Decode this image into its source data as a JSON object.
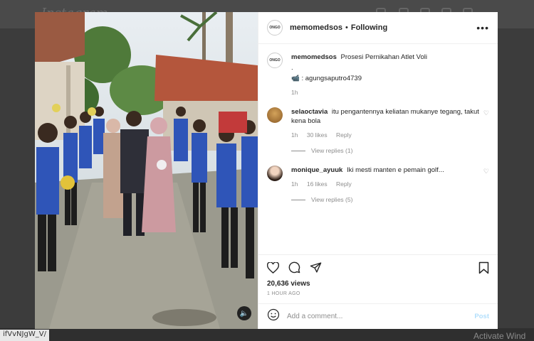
{
  "background": {
    "logo": "Instagram",
    "url_fragment": "ifVvNJgW_V/",
    "watermark": "Activate Wind"
  },
  "post": {
    "username": "memomedsos",
    "follow_status": "Following",
    "separator": "•",
    "avatar_text": "ONGO",
    "caption": {
      "username": "memomedsos",
      "text": "Prosesi Pernikahan Atlet Voli",
      "dot": ".",
      "credit": ": agungsaputro4739",
      "time": "1h"
    },
    "comments": [
      {
        "username": "selaoctavia",
        "text": "itu pengantennya keliatan mukanye tegang, takut kena bola",
        "time": "1h",
        "likes": "30 likes",
        "reply_label": "Reply",
        "view_replies": "View replies (1)"
      },
      {
        "username": "monique_ayuuk",
        "text": "Iki mesti manten e pemain golf...",
        "time": "1h",
        "likes": "16 likes",
        "reply_label": "Reply",
        "view_replies": "View replies (5)"
      }
    ],
    "views": "20,636 views",
    "posted_ago": "1 HOUR AGO",
    "add_comment_placeholder": "Add a comment...",
    "post_label": "Post",
    "icons": [
      "heart-icon",
      "comment-icon",
      "share-icon",
      "bookmark-icon",
      "emoji-icon",
      "sound-icon",
      "more-icon"
    ]
  },
  "colors": {
    "modal_bg": "#ffffff",
    "overlay": "#3c3c3c",
    "post_button_disabled": "#b2dffc",
    "muted_text": "#8e8e8e",
    "jersey_blue": "#2f55b8"
  }
}
